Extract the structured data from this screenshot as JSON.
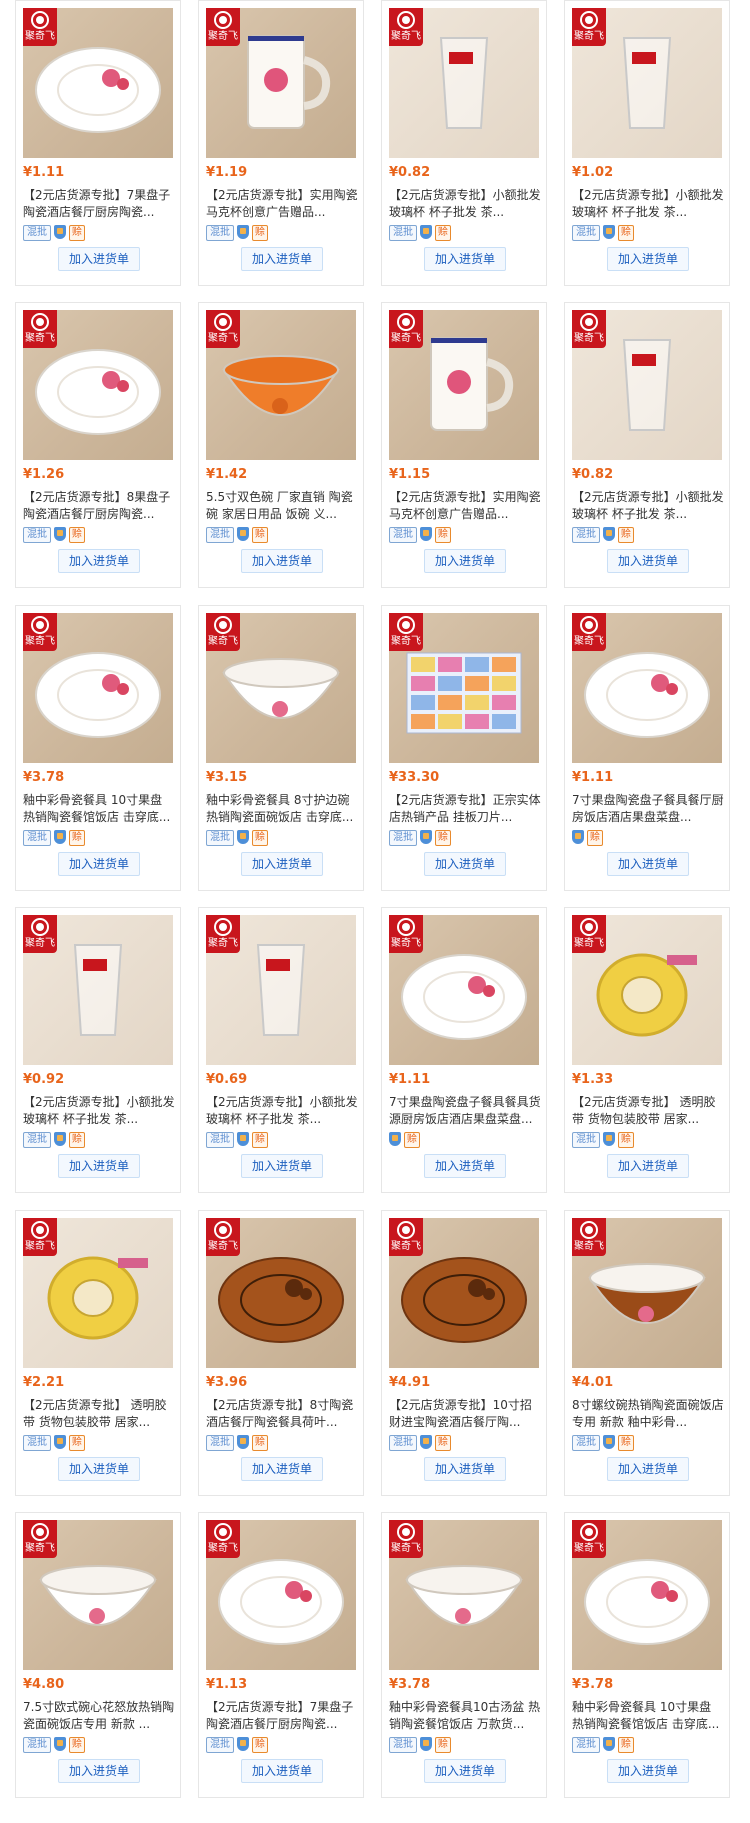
{
  "badge_text": "聚奇飞",
  "add_label": "加入进货单",
  "tag_mix_label": "混批",
  "tag_pay_label": "赊",
  "colors": {
    "price": "#e8641b",
    "badge": "#c8161d",
    "link": "#1d5fbf"
  },
  "products": [
    {
      "price": "¥1.11",
      "title": "【2元店货源专批】7果盘子陶瓷酒店餐厅厨房陶瓷...",
      "mix": true,
      "icon": "plate-icon"
    },
    {
      "price": "¥1.19",
      "title": "【2元店货源专批】实用陶瓷马克杯创意广告赠品...",
      "mix": true,
      "icon": "mug-icon"
    },
    {
      "price": "¥0.82",
      "title": "【2元店货源专批】小额批发玻璃杯 杯子批发 茶...",
      "mix": true,
      "icon": "glass-icon"
    },
    {
      "price": "¥1.02",
      "title": "【2元店货源专批】小额批发玻璃杯 杯子批发 茶...",
      "mix": true,
      "icon": "glass-icon"
    },
    {
      "price": "¥1.26",
      "title": "【2元店货源专批】8果盘子陶瓷酒店餐厅厨房陶瓷...",
      "mix": true,
      "icon": "plate-icon"
    },
    {
      "price": "¥1.42",
      "title": "5.5寸双色碗 厂家直销 陶瓷碗 家居日用品 饭碗 义...",
      "mix": true,
      "icon": "bowl-icon"
    },
    {
      "price": "¥1.15",
      "title": "【2元店货源专批】实用陶瓷马克杯创意广告赠品...",
      "mix": true,
      "icon": "mug-icon"
    },
    {
      "price": "¥0.82",
      "title": "【2元店货源专批】小额批发玻璃杯 杯子批发 茶...",
      "mix": true,
      "icon": "glass-icon"
    },
    {
      "price": "¥3.78",
      "title": "釉中彩骨瓷餐具 10寸果盘 热销陶瓷餐馆饭店 击穿底...",
      "mix": true,
      "icon": "plate-icon"
    },
    {
      "price": "¥3.15",
      "title": "釉中彩骨瓷餐具 8寸护边碗 热销陶瓷面碗饭店 击穿底...",
      "mix": true,
      "icon": "bowl-icon"
    },
    {
      "price": "¥33.30",
      "title": "【2元店货源专批】正宗实体店热销产品 挂板刀片...",
      "mix": true,
      "icon": "box-icon"
    },
    {
      "price": "¥1.11",
      "title": "7寸果盘陶瓷盘子餐具餐厅厨房饭店酒店果盘菜盘...",
      "mix": false,
      "icon": "plate-icon"
    },
    {
      "price": "¥0.92",
      "title": "【2元店货源专批】小额批发玻璃杯 杯子批发 茶...",
      "mix": true,
      "icon": "glass-icon"
    },
    {
      "price": "¥0.69",
      "title": "【2元店货源专批】小额批发玻璃杯 杯子批发 茶...",
      "mix": true,
      "icon": "glass-icon"
    },
    {
      "price": "¥1.11",
      "title": "7寸果盘陶瓷盘子餐具餐具货源厨房饭店酒店果盘菜盘...",
      "mix": false,
      "icon": "plate-icon"
    },
    {
      "price": "¥1.33",
      "title": "【2元店货源专批】 透明胶带 货物包装胶带 居家...",
      "mix": true,
      "icon": "tape-icon"
    },
    {
      "price": "¥2.21",
      "title": "【2元店货源专批】 透明胶带 货物包装胶带 居家...",
      "mix": true,
      "icon": "tape-icon"
    },
    {
      "price": "¥3.96",
      "title": "【2元店货源专批】8寸陶瓷酒店餐厅陶瓷餐具荷叶...",
      "mix": true,
      "icon": "plate-icon"
    },
    {
      "price": "¥4.91",
      "title": "【2元店货源专批】10寸招财进宝陶瓷酒店餐厅陶...",
      "mix": true,
      "icon": "plate-icon"
    },
    {
      "price": "¥4.01",
      "title": "8寸螺纹碗热销陶瓷面碗饭店专用 新款 釉中彩骨...",
      "mix": true,
      "icon": "bowl-icon"
    },
    {
      "price": "¥4.80",
      "title": "7.5寸欧式碗心花怒放热销陶瓷面碗饭店专用 新款 ...",
      "mix": true,
      "icon": "bowl-icon"
    },
    {
      "price": "¥1.13",
      "title": "【2元店货源专批】7果盘子陶瓷酒店餐厅厨房陶瓷...",
      "mix": true,
      "icon": "plate-icon"
    },
    {
      "price": "¥3.78",
      "title": "釉中彩骨瓷餐具10古汤盆 热销陶瓷餐馆饭店 万款货...",
      "mix": true,
      "icon": "bowl-icon"
    },
    {
      "price": "¥3.78",
      "title": "釉中彩骨瓷餐具 10寸果盘 热销陶瓷餐馆饭店 击穿底...",
      "mix": true,
      "icon": "plate-icon"
    }
  ]
}
